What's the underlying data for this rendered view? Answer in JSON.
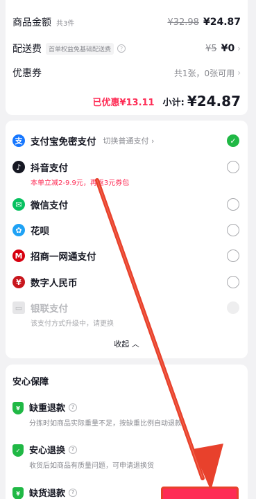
{
  "summary": {
    "goods_label": "商品金额",
    "goods_count": "共3件",
    "goods_original": "¥32.98",
    "goods_price": "¥24.87",
    "shipping_label": "配送费",
    "shipping_tag": "首单权益免基础配送费",
    "shipping_original": "¥5",
    "shipping_price": "¥0",
    "coupon_label": "优惠券",
    "coupon_value": "共1张，0张可用",
    "discount_text": "已优惠¥13.11",
    "subtotal_label": "小计:",
    "subtotal_value": "¥24.87"
  },
  "payments": {
    "items": [
      {
        "name": "支付宝免密支付",
        "switch": "切换普通支付",
        "icon": "alipay-icon",
        "selected": true
      },
      {
        "name": "抖音支付",
        "note": "本单立减2-9.9元，再返3元券包",
        "icon": "douyin-icon"
      },
      {
        "name": "微信支付",
        "icon": "wechat-icon"
      },
      {
        "name": "花呗",
        "icon": "huabei-icon"
      },
      {
        "name": "招商一网通支付",
        "icon": "cmb-icon"
      },
      {
        "name": "数字人民币",
        "icon": "ecny-icon"
      },
      {
        "name": "银联支付",
        "note": "该支付方式升级中，请更换",
        "icon": "unionpay-icon",
        "disabled": true
      }
    ],
    "collapse_label": "收起"
  },
  "guarantee": {
    "title": "安心保障",
    "items": [
      {
        "name": "缺重退款",
        "desc": "分拣时如商品实际重量不足，按缺重比例自动退款"
      },
      {
        "name": "安心退换",
        "desc": "收货后如商品有质量问题，可申请退换货"
      },
      {
        "name": "缺货退款",
        "desc": ""
      }
    ]
  },
  "colors": {
    "accent": "#fe2c55",
    "success": "#20b845",
    "annotation": "#e8412c"
  }
}
